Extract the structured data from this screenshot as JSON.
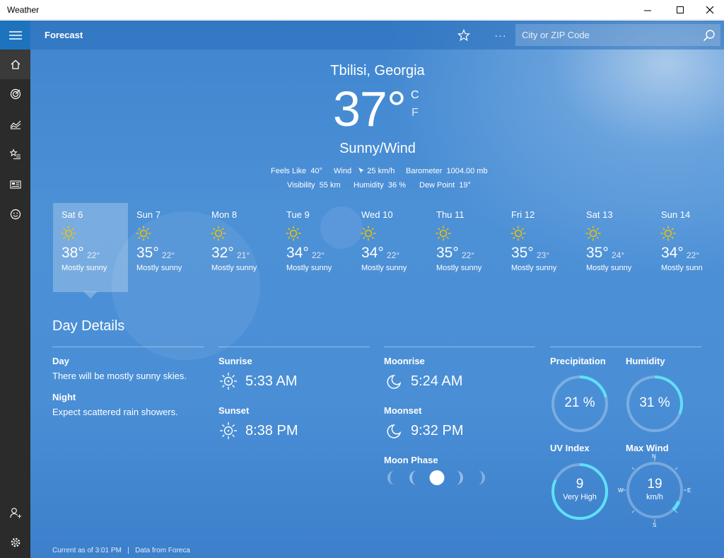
{
  "window": {
    "title": "Weather"
  },
  "header": {
    "page_title": "Forecast",
    "search_placeholder": "City or ZIP Code"
  },
  "current": {
    "location": "Tbilisi, Georgia",
    "temp": "37°",
    "unit_c": "C",
    "unit_f": "F",
    "condition": "Sunny/Wind",
    "feels_like_label": "Feels Like",
    "feels_like": "40°",
    "wind_label": "Wind",
    "wind": "25 km/h",
    "barometer_label": "Barometer",
    "barometer": "1004.00 mb",
    "visibility_label": "Visibility",
    "visibility": "55 km",
    "humidity_label": "Humidity",
    "humidity": "36 %",
    "dew_point_label": "Dew Point",
    "dew_point": "19°"
  },
  "forecast": [
    {
      "day": "Sat 6",
      "hi": "38°",
      "lo": "22°",
      "cond": "Mostly sunny"
    },
    {
      "day": "Sun 7",
      "hi": "35°",
      "lo": "22°",
      "cond": "Mostly sunny"
    },
    {
      "day": "Mon 8",
      "hi": "32°",
      "lo": "21°",
      "cond": "Mostly sunny"
    },
    {
      "day": "Tue 9",
      "hi": "34°",
      "lo": "22°",
      "cond": "Mostly sunny"
    },
    {
      "day": "Wed 10",
      "hi": "34°",
      "lo": "22°",
      "cond": "Mostly sunny"
    },
    {
      "day": "Thu 11",
      "hi": "35°",
      "lo": "22°",
      "cond": "Mostly sunny"
    },
    {
      "day": "Fri 12",
      "hi": "35°",
      "lo": "23°",
      "cond": "Mostly sunny"
    },
    {
      "day": "Sat 13",
      "hi": "35°",
      "lo": "24°",
      "cond": "Mostly sunny"
    },
    {
      "day": "Sun 14",
      "hi": "34°",
      "lo": "22°",
      "cond": "Mostly sunn"
    }
  ],
  "details": {
    "title": "Day Details",
    "day_label": "Day",
    "day_text": "There will be mostly sunny skies.",
    "night_label": "Night",
    "night_text": "Expect scattered rain showers.",
    "sunrise_label": "Sunrise",
    "sunrise": "5:33 AM",
    "sunset_label": "Sunset",
    "sunset": "8:38 PM",
    "moonrise_label": "Moonrise",
    "moonrise": "5:24 AM",
    "moonset_label": "Moonset",
    "moonset": "9:32 PM",
    "moon_phase_label": "Moon Phase",
    "precip_label": "Precipitation",
    "precip": "21 %",
    "precip_fraction": 0.21,
    "humidity_label": "Humidity",
    "humidity": "31 %",
    "humidity_fraction": 0.31,
    "uv_label": "UV Index",
    "uv": "9",
    "uv_desc": "Very High",
    "uv_fraction": 0.82,
    "wind_label": "Max Wind",
    "wind": "19",
    "wind_unit": "km/h",
    "compass_n": "N",
    "compass_e": "E",
    "compass_s": "S",
    "compass_w": "W"
  },
  "footer": {
    "current_as_of": "Current as of 3:01 PM",
    "separator": "|",
    "source": "Data from Foreca"
  },
  "colors": {
    "accent": "#1e73be",
    "gauge": "#5ee0f7",
    "sun": "#f2c300"
  }
}
